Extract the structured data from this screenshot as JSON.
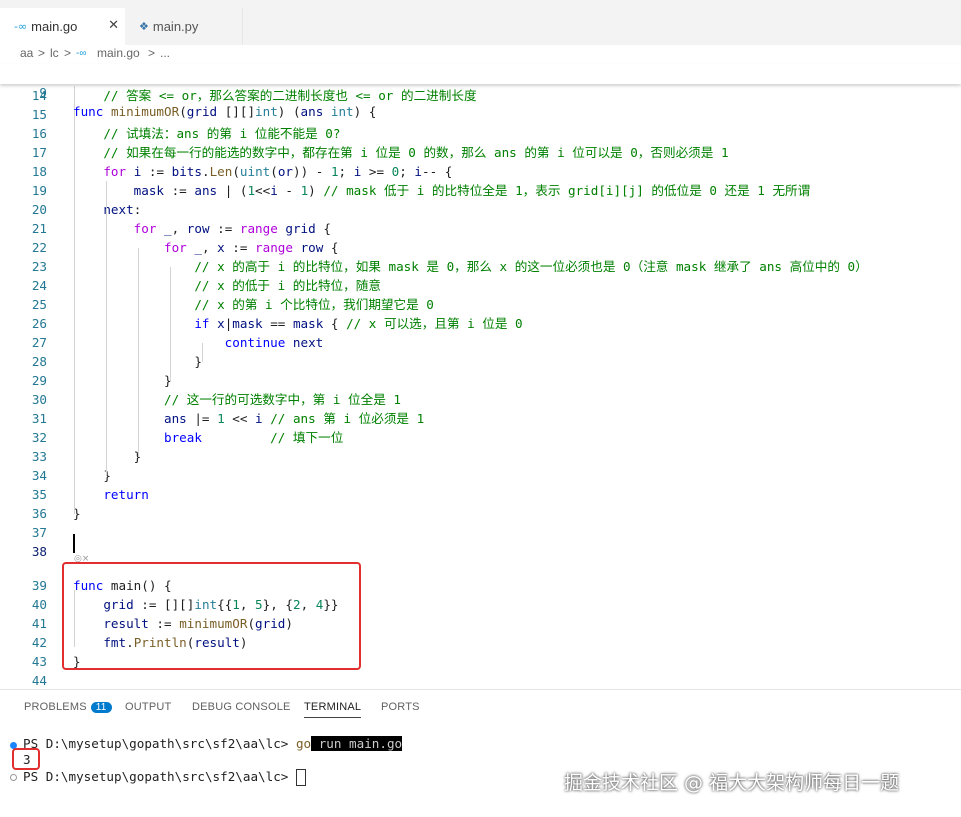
{
  "tabs": [
    {
      "icon": "go-icon",
      "label": "main.go",
      "active": true
    },
    {
      "icon": "python-icon",
      "label": "main.py",
      "active": false
    }
  ],
  "breadcrumb": [
    "aa",
    ">",
    "lc",
    ">",
    "main.go",
    ">",
    "..."
  ],
  "sticky": {
    "num": "9",
    "text": "func minimumOR(grid [][]int) (ans int) {"
  },
  "lines": [
    {
      "num": "14",
      "text": "    // 答案 <= or，那么答案的二进制长度也 <= or 的二进制长度"
    },
    {
      "num": "15",
      "text": ""
    },
    {
      "num": "16",
      "text": "    // 试填法：ans 的第 i 位能不能是 0?"
    },
    {
      "num": "17",
      "text": "    // 如果在每一行的能选的数字中，都存在第 i 位是 0 的数，那么 ans 的第 i 位可以是 0，否则必须是 1"
    },
    {
      "num": "18",
      "text": "    for i := bits.Len(uint(or)) - 1; i >= 0; i-- {"
    },
    {
      "num": "19",
      "text": "        mask := ans | (1<<i - 1) // mask 低于 i 的比特位全是 1，表示 grid[i][j] 的低位是 0 还是 1 无所谓"
    },
    {
      "num": "20",
      "text": "    next:"
    },
    {
      "num": "21",
      "text": "        for _, row := range grid {"
    },
    {
      "num": "22",
      "text": "            for _, x := range row {"
    },
    {
      "num": "23",
      "text": "                // x 的高于 i 的比特位，如果 mask 是 0，那么 x 的这一位必须也是 0（注意 mask 继承了 ans 高位中的 0）"
    },
    {
      "num": "24",
      "text": "                // x 的低于 i 的比特位，随意"
    },
    {
      "num": "25",
      "text": "                // x 的第 i 个比特位，我们期望它是 0"
    },
    {
      "num": "26",
      "text": "                if x|mask == mask { // x 可以选，且第 i 位是 0"
    },
    {
      "num": "27",
      "text": "                    continue next"
    },
    {
      "num": "28",
      "text": "                }"
    },
    {
      "num": "29",
      "text": "            }"
    },
    {
      "num": "30",
      "text": "            // 这一行的可选数字中，第 i 位全是 1"
    },
    {
      "num": "31",
      "text": "            ans |= 1 << i // ans 第 i 位必须是 1"
    },
    {
      "num": "32",
      "text": "            break         // 填下一位"
    },
    {
      "num": "33",
      "text": "        }"
    },
    {
      "num": "34",
      "text": "    }"
    },
    {
      "num": "35",
      "text": "    return"
    },
    {
      "num": "36",
      "text": "}"
    },
    {
      "num": "37",
      "text": ""
    },
    {
      "num": "38",
      "text": ""
    },
    {
      "num": "39",
      "text": "func main() {"
    },
    {
      "num": "40",
      "text": "    grid := [][]int{{1, 5}, {2, 4}}"
    },
    {
      "num": "41",
      "text": "    result := minimumOR(grid)"
    },
    {
      "num": "42",
      "text": "    fmt.Println(result)"
    },
    {
      "num": "43",
      "text": "}"
    },
    {
      "num": "44",
      "text": ""
    }
  ],
  "panel_tabs": [
    {
      "label": "PROBLEMS",
      "badge": "11"
    },
    {
      "label": "OUTPUT"
    },
    {
      "label": "DEBUG CONSOLE"
    },
    {
      "label": "TERMINAL",
      "active": true
    },
    {
      "label": "PORTS"
    }
  ],
  "terminal": {
    "prompt1": "PS D:\\mysetup\\gopath\\src\\sf2\\aa\\lc> ",
    "cmd_go": "go",
    "cmd_rest": " run main.go",
    "output": "3",
    "prompt2": "PS D:\\mysetup\\gopath\\src\\sf2\\aa\\lc> "
  },
  "watermark": "掘金技术社区 @ 福大大架构师每日一题",
  "colors": {
    "highlight_box": "#e12e2e",
    "accent": "#007acc"
  }
}
